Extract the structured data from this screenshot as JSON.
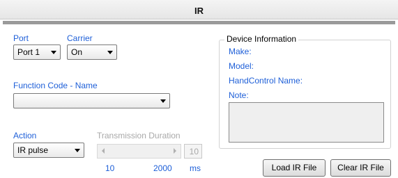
{
  "window": {
    "title": "IR"
  },
  "port": {
    "label": "Port",
    "value": "Port 1"
  },
  "carrier": {
    "label": "Carrier",
    "value": "On"
  },
  "function_code": {
    "label": "Function Code - Name",
    "value": ""
  },
  "action": {
    "label": "Action",
    "value": "IR pulse"
  },
  "transmission": {
    "label": "Transmission Duration",
    "value": "10",
    "min": "10",
    "max": "2000",
    "unit": "ms"
  },
  "device_info": {
    "title": "Device Information",
    "make_label": "Make:",
    "model_label": "Model:",
    "handcontrol_label": "HandControl Name:",
    "note_label": "Note:"
  },
  "buttons": {
    "load": "Load IR File",
    "clear": "Clear IR File"
  },
  "colors": {
    "label_blue": "#1e5fd8",
    "disabled_gray": "#a8a8a8"
  }
}
